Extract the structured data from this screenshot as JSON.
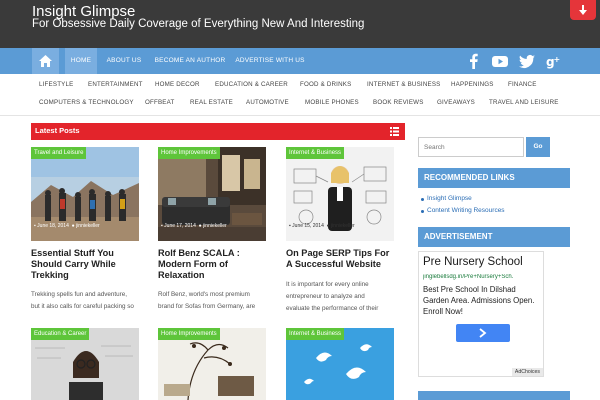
{
  "header": {
    "title": "Insight Glimpse",
    "tagline": "For Obsessive Daily Coverage of Everything New And Interesting"
  },
  "nav": {
    "items": [
      "HOME",
      "ABOUT US",
      "BECOME AN AUTHOR",
      "ADVERTISE WITH US"
    ],
    "active": "HOME",
    "social_icons": [
      "facebook-icon",
      "youtube-icon",
      "twitter-icon",
      "google-plus-icon"
    ]
  },
  "categories": {
    "row1": [
      "LIFESTYLE",
      "ENTERTAINMENT",
      "HOME DECOR",
      "EDUCATION & CAREER",
      "FOOD & DRINKS",
      "INTERNET & BUSINESS",
      "HAPPENINGS",
      "FINANCE"
    ],
    "row2": [
      "COMPUTERS & TECHNOLOGY",
      "OFFBEAT",
      "REAL ESTATE",
      "AUTOMOTIVE",
      "MOBILE PHONES",
      "BOOK REVIEWS",
      "GIVEAWAYS",
      "TRAVEL AND LEISURE"
    ]
  },
  "latest": {
    "heading": "Latest Posts",
    "posts": [
      {
        "category": "Travel and Leisure",
        "date": "June 18, 2014",
        "author": "jinniekeller",
        "title": "Essential Stuff You Should Carry While Trekking",
        "excerpt": [
          "Trekking spells fun and adventure,",
          "but it also calls for careful packing so"
        ]
      },
      {
        "category": "Home Improvements",
        "date": "June 17, 2014",
        "author": "jinniekeller",
        "title": "Rolf Benz SCALA : Modern Form of Relaxation",
        "excerpt": [
          "Rolf Benz, world's most premium",
          "brand for Sofas from Germany, are"
        ]
      },
      {
        "category": "Internet & Business",
        "date": "June 15, 2014",
        "author": "jinniekeller",
        "title": "On Page SERP Tips For A Successful Website",
        "excerpt": [
          "It is important for every online",
          "entrepreneur to analyze and",
          "evaluate the performance of their"
        ]
      },
      {
        "category": "Education & Career"
      },
      {
        "category": "Home Improvements"
      },
      {
        "category": "Internet & Business"
      }
    ]
  },
  "sidebar": {
    "search_placeholder": "Search",
    "search_button": "Go",
    "recommended_title": "RECOMMENDED LINKS",
    "recommended_links": [
      "Insight Glimpse",
      "Content Writing Resources"
    ],
    "ad_title": "ADVERTISEMENT",
    "ad": {
      "headline": "Pre Nursery School",
      "url": "jinglebellsdg.in/Pre+Nursery+Sch.",
      "body": "Best Pre School In Dilshad Garden Area. Admissions Open. Enroll Now!",
      "choices": "AdChoices"
    }
  },
  "colors": {
    "header_bg": "#3a3a3a",
    "nav_bg": "#5b9bd5",
    "accent_red": "#e3242b",
    "category_badge": "#5ec53a",
    "link_blue": "#2a6db5"
  }
}
